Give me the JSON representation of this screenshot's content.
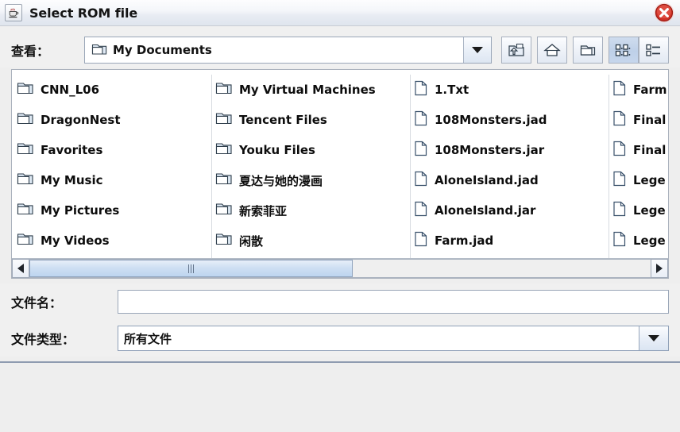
{
  "window": {
    "title": "Select ROM file",
    "app_icon": "java-coffee-cup-icon",
    "close_icon": "close-icon"
  },
  "toolbar": {
    "lookin_label": "查看：",
    "current_folder": "My Documents",
    "folder_icon": "folder-icon",
    "combo_arrow_icon": "chevron-down-icon",
    "buttons": [
      {
        "name": "up-one-level-button",
        "icon": "up-folder-icon",
        "selected": false
      },
      {
        "name": "home-button",
        "icon": "home-icon",
        "selected": false
      },
      {
        "name": "new-folder-button",
        "icon": "new-folder-icon",
        "selected": false
      },
      {
        "name": "list-view-button",
        "icon": "list-view-icon",
        "selected": true
      },
      {
        "name": "details-view-button",
        "icon": "details-view-icon",
        "selected": false
      }
    ]
  },
  "file_list": {
    "columns": [
      {
        "items": [
          {
            "label": "CNN_L06",
            "type": "folder"
          },
          {
            "label": "DragonNest",
            "type": "folder"
          },
          {
            "label": "Favorites",
            "type": "folder"
          },
          {
            "label": "My Music",
            "type": "folder"
          },
          {
            "label": "My Pictures",
            "type": "folder"
          },
          {
            "label": "My Videos",
            "type": "folder"
          }
        ]
      },
      {
        "items": [
          {
            "label": "My Virtual Machines",
            "type": "folder"
          },
          {
            "label": "Tencent Files",
            "type": "folder"
          },
          {
            "label": "Youku Files",
            "type": "folder"
          },
          {
            "label": "夏达与她的漫画",
            "type": "folder"
          },
          {
            "label": "新索菲亚",
            "type": "folder"
          },
          {
            "label": "闲散",
            "type": "folder"
          }
        ]
      },
      {
        "items": [
          {
            "label": "1.Txt",
            "type": "file"
          },
          {
            "label": "108Monsters.jad",
            "type": "file"
          },
          {
            "label": "108Monsters.jar",
            "type": "file"
          },
          {
            "label": "AloneIsland.jad",
            "type": "file"
          },
          {
            "label": "AloneIsland.jar",
            "type": "file"
          },
          {
            "label": "Farm.jad",
            "type": "file"
          }
        ]
      },
      {
        "items": [
          {
            "label": "Farm",
            "type": "file"
          },
          {
            "label": "Final",
            "type": "file"
          },
          {
            "label": "Final",
            "type": "file"
          },
          {
            "label": "Lege",
            "type": "file"
          },
          {
            "label": "Lege",
            "type": "file"
          },
          {
            "label": "Lege",
            "type": "file"
          }
        ]
      }
    ],
    "scrollbar": {
      "left_arrow_icon": "scroll-left-icon",
      "right_arrow_icon": "scroll-right-icon",
      "thumb_width_percent": 52
    }
  },
  "form": {
    "filename_label": "文件名：",
    "filename_value": "",
    "filetype_label": "文件类型：",
    "filetype_value": "所有文件",
    "filetype_arrow_icon": "chevron-down-icon"
  },
  "colors": {
    "accent": "#bdd5ef",
    "titlebar": "#f2f5fa",
    "close_red": "#d42a20",
    "panel": "#f0f0f0"
  }
}
